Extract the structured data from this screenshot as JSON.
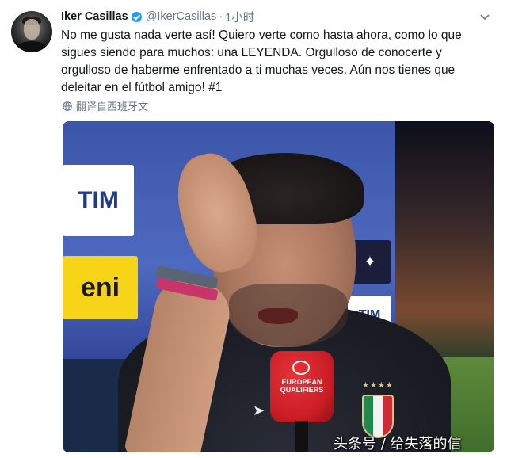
{
  "tweet": {
    "author": {
      "name": "Iker Casillas",
      "handle": "@IkerCasillas",
      "verified": true
    },
    "separator": "·",
    "time": "1小时",
    "text": "No me gusta nada verte así! Quiero verte como hasta ahora, como lo que sigues siendo para muchos: una LEYENDA. Orgulloso de conocerte y orgulloso de haberme enfrentado a ti muchas veces. Aún nos tienes que deleitar en el fútbol amigo! #1",
    "translate_label": "翻译自西班牙文",
    "media": {
      "sponsors": [
        "TIM",
        "eni",
        "TIM",
        "TIM"
      ],
      "mic_text": "EUROPEAN QUALIFIERS",
      "watermark": "头条号 / 给失落的信"
    }
  },
  "colors": {
    "link": "#1da1f2",
    "secondary_text": "#657786",
    "primary_text": "#14171a"
  }
}
